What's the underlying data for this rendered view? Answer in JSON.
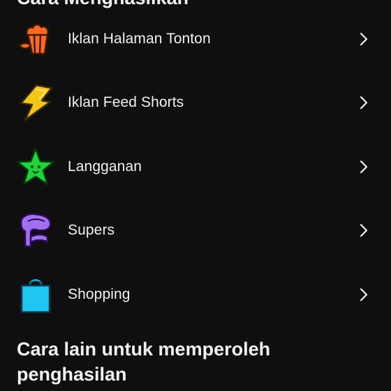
{
  "top_section": {
    "title": "Cara Menghasilkan"
  },
  "items": [
    {
      "label": "Iklan Halaman Tonton",
      "icon": "popcorn-icon",
      "color": "#ff6a1f"
    },
    {
      "label": "Iklan Feed Shorts",
      "icon": "lightning-icon",
      "color": "#f5c518"
    },
    {
      "label": "Langganan",
      "icon": "star-icon",
      "color": "#1fd33a"
    },
    {
      "label": "Supers",
      "icon": "super-chat-icon",
      "color": "#a070f0"
    },
    {
      "label": "Shopping",
      "icon": "shopping-bag-icon",
      "color": "#1fc7f0"
    }
  ],
  "bottom_section": {
    "title": "Cara lain untuk memperoleh penghasilan"
  },
  "colors": {
    "background": "#0f0f0f",
    "text": "#f1f1f1"
  }
}
